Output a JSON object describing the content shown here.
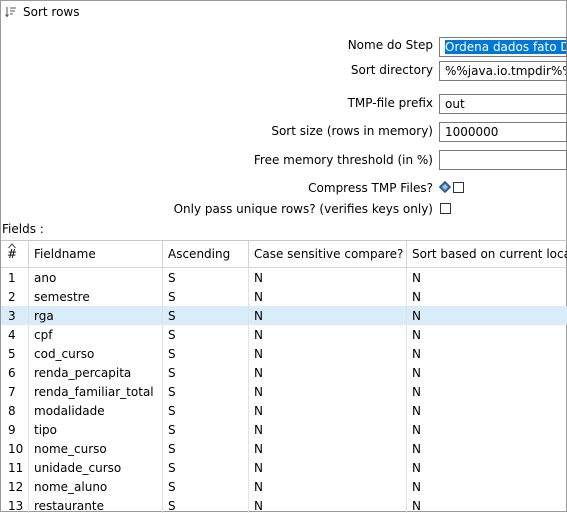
{
  "window": {
    "title": "Sort rows"
  },
  "form": {
    "step_name_label": "Nome do Step",
    "step_name_value": "Ordena dados fato DW",
    "sort_directory_label": "Sort directory",
    "sort_directory_value": "%%java.io.tmpdir%%",
    "tmp_prefix_label": "TMP-file prefix",
    "tmp_prefix_value": "out",
    "sort_size_label": "Sort size (rows in memory)",
    "sort_size_value": "1000000",
    "free_memory_label": "Free memory threshold (in %)",
    "free_memory_value": "",
    "compress_label": "Compress TMP Files?",
    "unique_label": "Only pass unique rows? (verifies keys only)"
  },
  "fields_label": "Fields :",
  "table": {
    "headers": [
      "#",
      "Fieldname",
      "Ascending",
      "Case sensitive compare?",
      "Sort based on current locale?"
    ],
    "rows": [
      [
        "1",
        "ano",
        "S",
        "N",
        "N"
      ],
      [
        "2",
        "semestre",
        "S",
        "N",
        "N"
      ],
      [
        "3",
        "rga",
        "S",
        "N",
        "N"
      ],
      [
        "4",
        "cpf",
        "S",
        "N",
        "N"
      ],
      [
        "5",
        "cod_curso",
        "S",
        "N",
        "N"
      ],
      [
        "6",
        "renda_percapita",
        "S",
        "N",
        "N"
      ],
      [
        "7",
        "renda_familiar_total",
        "S",
        "N",
        "N"
      ],
      [
        "8",
        "modalidade",
        "S",
        "N",
        "N"
      ],
      [
        "9",
        "tipo",
        "S",
        "N",
        "N"
      ],
      [
        "10",
        "nome_curso",
        "S",
        "N",
        "N"
      ],
      [
        "11",
        "unidade_curso",
        "S",
        "N",
        "N"
      ],
      [
        "12",
        "nome_aluno",
        "S",
        "N",
        "N"
      ],
      [
        "13",
        "restaurante",
        "S",
        "N",
        "N"
      ]
    ],
    "selected_row": 2
  },
  "colors": {
    "selection": "#0078d7",
    "row_highlight": "#d9ecfa",
    "diamond": "#3b6ea8"
  }
}
